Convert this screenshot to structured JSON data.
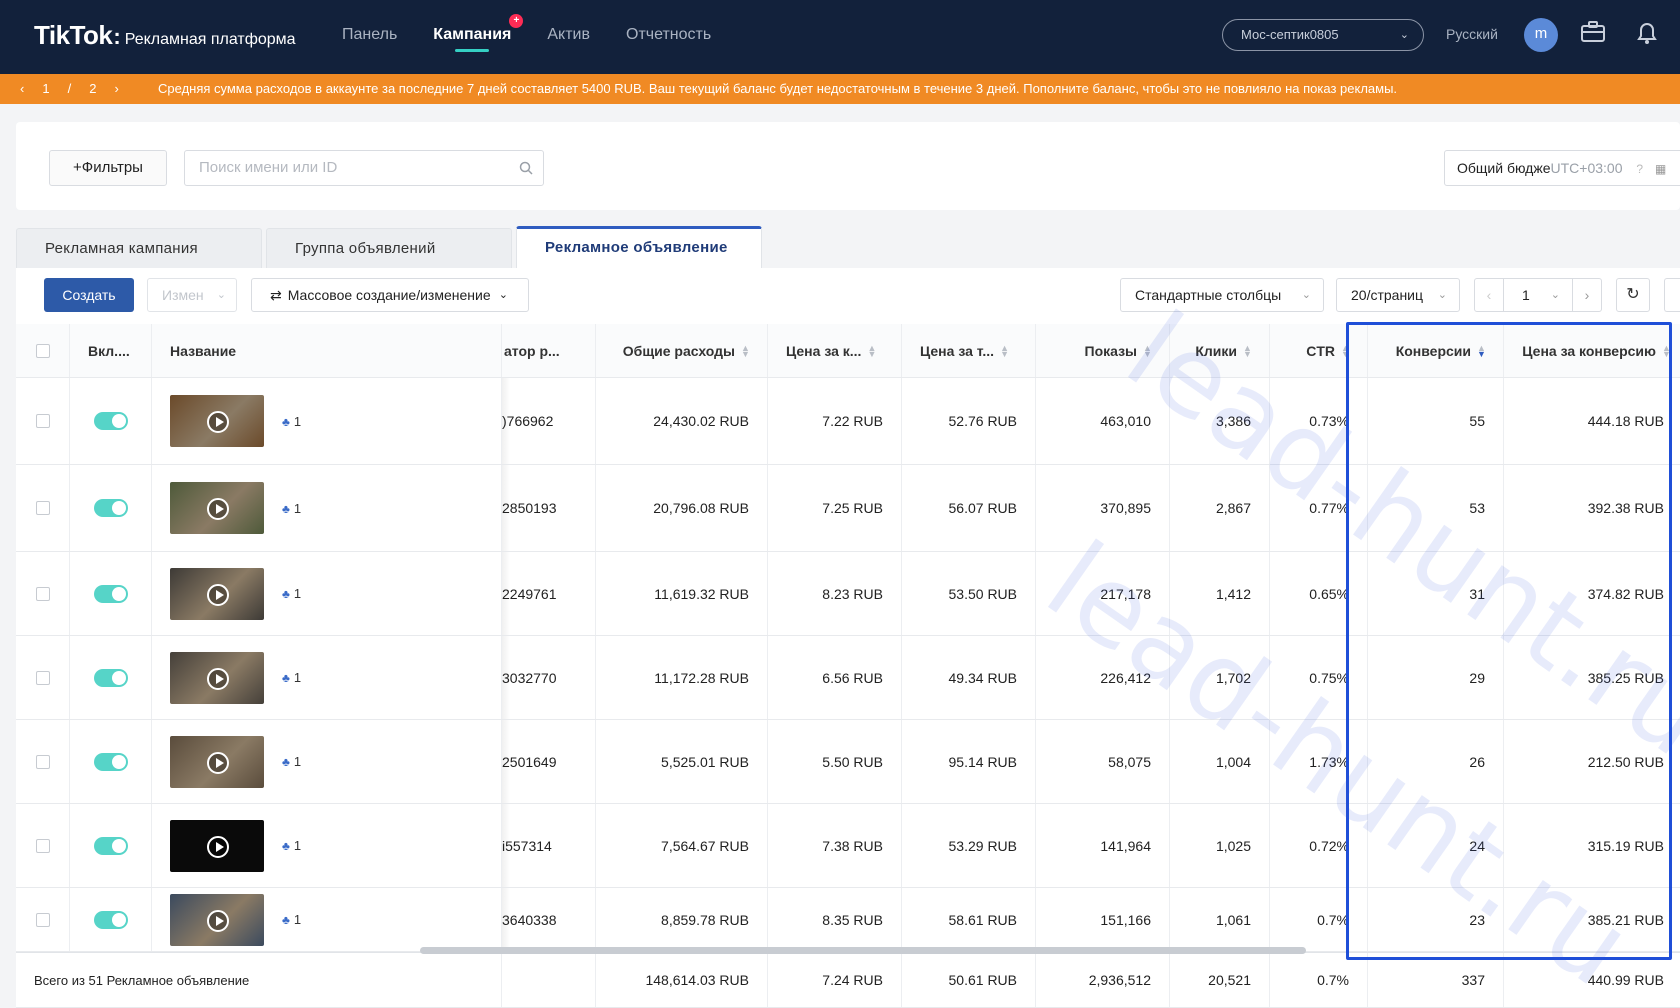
{
  "header": {
    "logo": "TikTok",
    "logo_sub": "Рекламная платформа",
    "nav": [
      {
        "label": "Панель"
      },
      {
        "label": "Кампания",
        "active": true
      },
      {
        "label": "Актив"
      },
      {
        "label": "Отчетность"
      }
    ],
    "account": "Мос-септик0805",
    "language": "Русский",
    "avatar_letter": "m"
  },
  "banner": {
    "page_current": "1",
    "page_sep": "/",
    "page_total": "2",
    "message": "Средняя сумма расходов в аккаунте за последние 7 дней составляет 5400 RUB. Ваш текущий баланс будет недостаточным в течение 3 дней. Пополните баланс, чтобы это не повлияло на показ рекламы."
  },
  "filters": {
    "filter_button": "+Фильтры",
    "search_placeholder": "Поиск имени или ID",
    "budget_label": "Общий бюдже",
    "timezone": "UTC+03:00"
  },
  "tabs": [
    {
      "label": "Рекламная кампания"
    },
    {
      "label": "Группа объявлений"
    },
    {
      "label": "Рекламное объявление",
      "active": true
    }
  ],
  "toolbar": {
    "create": "Создать",
    "edit": "Измен",
    "bulk": "Массовое создание/изменение",
    "columns": "Стандартные столбцы",
    "per_page": "20/страниц",
    "page": "1"
  },
  "table": {
    "headers": {
      "on": "Вкл....",
      "name": "Название",
      "id": "атор р...",
      "spend": "Общие расходы",
      "cpc": "Цена за к...",
      "cpm": "Цена за т...",
      "impressions": "Показы",
      "clicks": "Клики",
      "ctr": "CTR",
      "conversions": "Конверсии",
      "cpa": "Цена за конверсию"
    },
    "rows": [
      {
        "group": "1",
        "id": ")766962",
        "spend": "24,430.02 RUB",
        "cpc": "7.22 RUB",
        "cpm": "52.76 RUB",
        "impressions": "463,010",
        "clicks": "3,386",
        "ctr": "0.73%",
        "conversions": "55",
        "cpa": "444.18 RUB",
        "thumb": "#6b4a2a"
      },
      {
        "group": "1",
        "id": "2850193",
        "spend": "20,796.08 RUB",
        "cpc": "7.25 RUB",
        "cpm": "56.07 RUB",
        "impressions": "370,895",
        "clicks": "2,867",
        "ctr": "0.77%",
        "conversions": "53",
        "cpa": "392.38 RUB",
        "thumb": "#4e5a3a"
      },
      {
        "group": "1",
        "id": "2249761",
        "spend": "11,619.32 RUB",
        "cpc": "8.23 RUB",
        "cpm": "53.50 RUB",
        "impressions": "217,178",
        "clicks": "1,412",
        "ctr": "0.65%",
        "conversions": "31",
        "cpa": "374.82 RUB",
        "thumb": "#3d3a36"
      },
      {
        "group": "1",
        "id": "3032770",
        "spend": "11,172.28 RUB",
        "cpc": "6.56 RUB",
        "cpm": "49.34 RUB",
        "impressions": "226,412",
        "clicks": "1,702",
        "ctr": "0.75%",
        "conversions": "29",
        "cpa": "385.25 RUB",
        "thumb": "#45403a"
      },
      {
        "group": "1",
        "id": "2501649",
        "spend": "5,525.01 RUB",
        "cpc": "5.50 RUB",
        "cpm": "95.14 RUB",
        "impressions": "58,075",
        "clicks": "1,004",
        "ctr": "1.73%",
        "conversions": "26",
        "cpa": "212.50 RUB",
        "thumb": "#5a4c3c"
      },
      {
        "group": "1",
        "id": "i557314",
        "spend": "7,564.67 RUB",
        "cpc": "7.38 RUB",
        "cpm": "53.29 RUB",
        "impressions": "141,964",
        "clicks": "1,025",
        "ctr": "0.72%",
        "conversions": "24",
        "cpa": "315.19 RUB",
        "thumb": "#0a0a0a"
      },
      {
        "group": "1",
        "id": "3640338",
        "spend": "8,859.78 RUB",
        "cpc": "8.35 RUB",
        "cpm": "58.61 RUB",
        "impressions": "151,166",
        "clicks": "1,061",
        "ctr": "0.7%",
        "conversions": "23",
        "cpa": "385.21 RUB",
        "thumb": "#3b4a5e"
      }
    ],
    "total": {
      "label": "Всего из 51 Рекламное объявление",
      "spend": "148,614.03 RUB",
      "cpc": "7.24 RUB",
      "cpm": "50.61 RUB",
      "impressions": "2,936,512",
      "clicks": "20,521",
      "ctr": "0.7%",
      "conversions": "337",
      "cpa": "440.99 RUB"
    }
  },
  "watermark": "lead-hunt.ru",
  "colors": {
    "topbar": "#12213b",
    "banner": "#f08a24",
    "primary": "#2d5aa8",
    "toggle": "#56d4c8",
    "highlight": "#1f4fd8"
  }
}
